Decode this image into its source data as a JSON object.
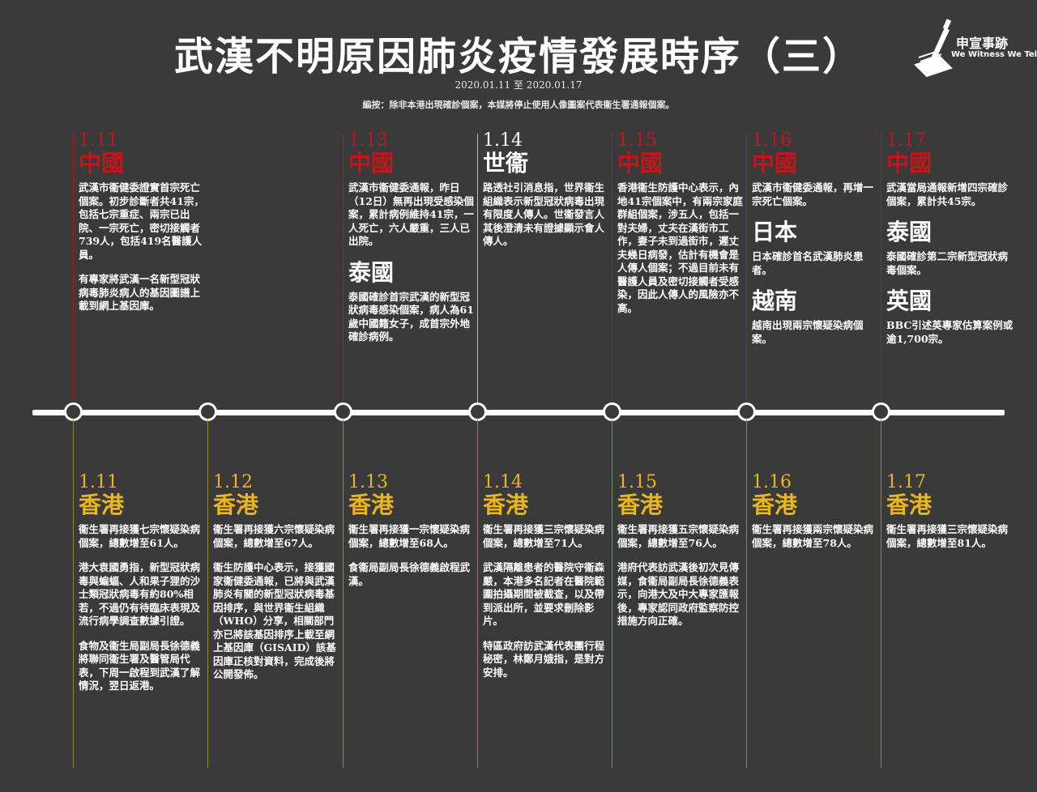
{
  "header": {
    "title": "武漢不明原因肺炎疫情發展時序（三）",
    "date_range": "2020.01.11 至 2020.01.17",
    "note": "編按：除非本港出現確診個案，本媒將停止使用人像圖案代表衞生署通報個案。"
  },
  "logo": {
    "name_cn": "申宣事跡",
    "name_en": "We Witness We Tell",
    "icon": "pen-writing-paper-icon"
  },
  "colors": {
    "background": "#3a3a3a",
    "mainland": "#c0181a",
    "hongkong": "#e9b61e",
    "timeline": "#ffffff"
  },
  "top_events": [
    {
      "date": "1.11",
      "sections": [
        {
          "region": "中國",
          "paragraphs": [
            "武漢市衞健委證實首宗死亡個案。初步診斷者共41宗，包括七宗重症、兩宗已出院、一宗死亡，密切接觸者739人，包括419名醫護人員。",
            "有專家將武漢一名新型冠狀病毒肺炎病人的基因圖譜上載到網上基因庫。"
          ]
        }
      ]
    },
    {
      "date": "1.13",
      "sections": [
        {
          "region": "中國",
          "paragraphs": [
            "武漢市衞健委通報，昨日（12日）無再出現受感染個案，累計病例維持41宗，一人死亡，六人嚴重，三人已出院。"
          ]
        },
        {
          "region": "泰國",
          "paragraphs": [
            "泰國確診首宗武漢的新型冠狀病毒感染個案，病人為61歲中國籍女子，成首宗外地確診病例。"
          ]
        }
      ]
    },
    {
      "date": "1.14",
      "sections": [
        {
          "region": "世衞",
          "paragraphs": [
            "路透社引消息指，世界衞生組織表示新型冠狀病毒出現有限度人傳人。世衞發言人其後澄清未有證據顯示會人傳人。"
          ]
        }
      ]
    },
    {
      "date": "1.15",
      "sections": [
        {
          "region": "中國",
          "paragraphs": [
            "香港衞生防護中心表示，內地41宗個案中，有兩宗家庭群組個案，涉五人，包括一對夫婦，丈夫在漢街市工作，妻子未到過街市，遲丈夫幾日病發，估計有機會是人傳人個案；不過目前未有醫護人員及密切接觸者受感染，因此人傳人的風險亦不高。"
          ]
        }
      ]
    },
    {
      "date": "1.16",
      "sections": [
        {
          "region": "中國",
          "paragraphs": [
            "武漢市衞健委通報，再增一宗死亡個案。"
          ]
        },
        {
          "region": "日本",
          "paragraphs": [
            "日本確診首名武漢肺炎患者。"
          ]
        },
        {
          "region": "越南",
          "paragraphs": [
            "越南出現兩宗懷疑染病個案。"
          ]
        }
      ]
    },
    {
      "date": "1.17",
      "sections": [
        {
          "region": "中國",
          "paragraphs": [
            "武漢當局通報新增四宗確診個案，累計共45宗。"
          ]
        },
        {
          "region": "泰國",
          "paragraphs": [
            "泰國確診第二宗新型冠狀病毒個案。"
          ]
        },
        {
          "region": "英國",
          "paragraphs": [
            "BBC引述英專家估算案例或逾1,700宗。"
          ]
        }
      ]
    }
  ],
  "bottom_events": [
    {
      "date": "1.11",
      "region": "香港",
      "paragraphs": [
        "衞生署再接獲七宗懷疑染病個案，總數增至61人。",
        "港大袁國勇指，新型冠狀病毒與蝙蝠、人和果子狸的沙士類冠狀病毒有約80%相若，不過仍有待臨床表現及流行病學調查數據引證。",
        "食物及衞生局副局長徐德義將聯同衞生署及醫管局代表，下周一啟程到武漢了解情況，翌日返港。"
      ]
    },
    {
      "date": "1.12",
      "region": "香港",
      "paragraphs": [
        "衞生署再接獲六宗懷疑染病個案，總數增至67人。",
        "衞生防護中心表示，接獲國家衞健委通報，已將與武漢肺炎有關的新型冠狀病毒基因排序，與世界衞生組織（WHO）分享，相關部門亦已將該基因排序上載至網上基因庫（GISAID）該基因庫正核對資料，完成後將公開發佈。"
      ]
    },
    {
      "date": "1.13",
      "region": "香港",
      "paragraphs": [
        "衞生署再接獲一宗懷疑染病個案，總數增至68人。",
        "食衞局副局長徐德義啟程武漢。"
      ]
    },
    {
      "date": "1.14",
      "region": "香港",
      "paragraphs": [
        "衞生署再接獲三宗懷疑染病個案，總數增至71人。",
        "武漢隔離患者的醫院守衞森嚴，本港多名記者在醫院範圍拍攝期間被截查，以及帶到派出所，並要求刪除影片。",
        "特區政府訪武漢代表團行程秘密，林鄭月娥指，是對方安排。"
      ]
    },
    {
      "date": "1.15",
      "region": "香港",
      "paragraphs": [
        "衞生署再接獲五宗懷疑染病個案，總數增至76人。",
        "港府代表訪武漢後初次見傳媒，食衞局副局長徐德義表示，向港大及中大專家匯報後，專家認同政府監察防控措施方向正確。"
      ]
    },
    {
      "date": "1.16",
      "region": "香港",
      "paragraphs": [
        "衞生署再接獲兩宗懷疑染病個案，總數增至78人。"
      ]
    },
    {
      "date": "1.17",
      "region": "香港",
      "paragraphs": [
        "衞生署再接獲三宗懷疑染病個案，總數增至81人。"
      ]
    }
  ]
}
